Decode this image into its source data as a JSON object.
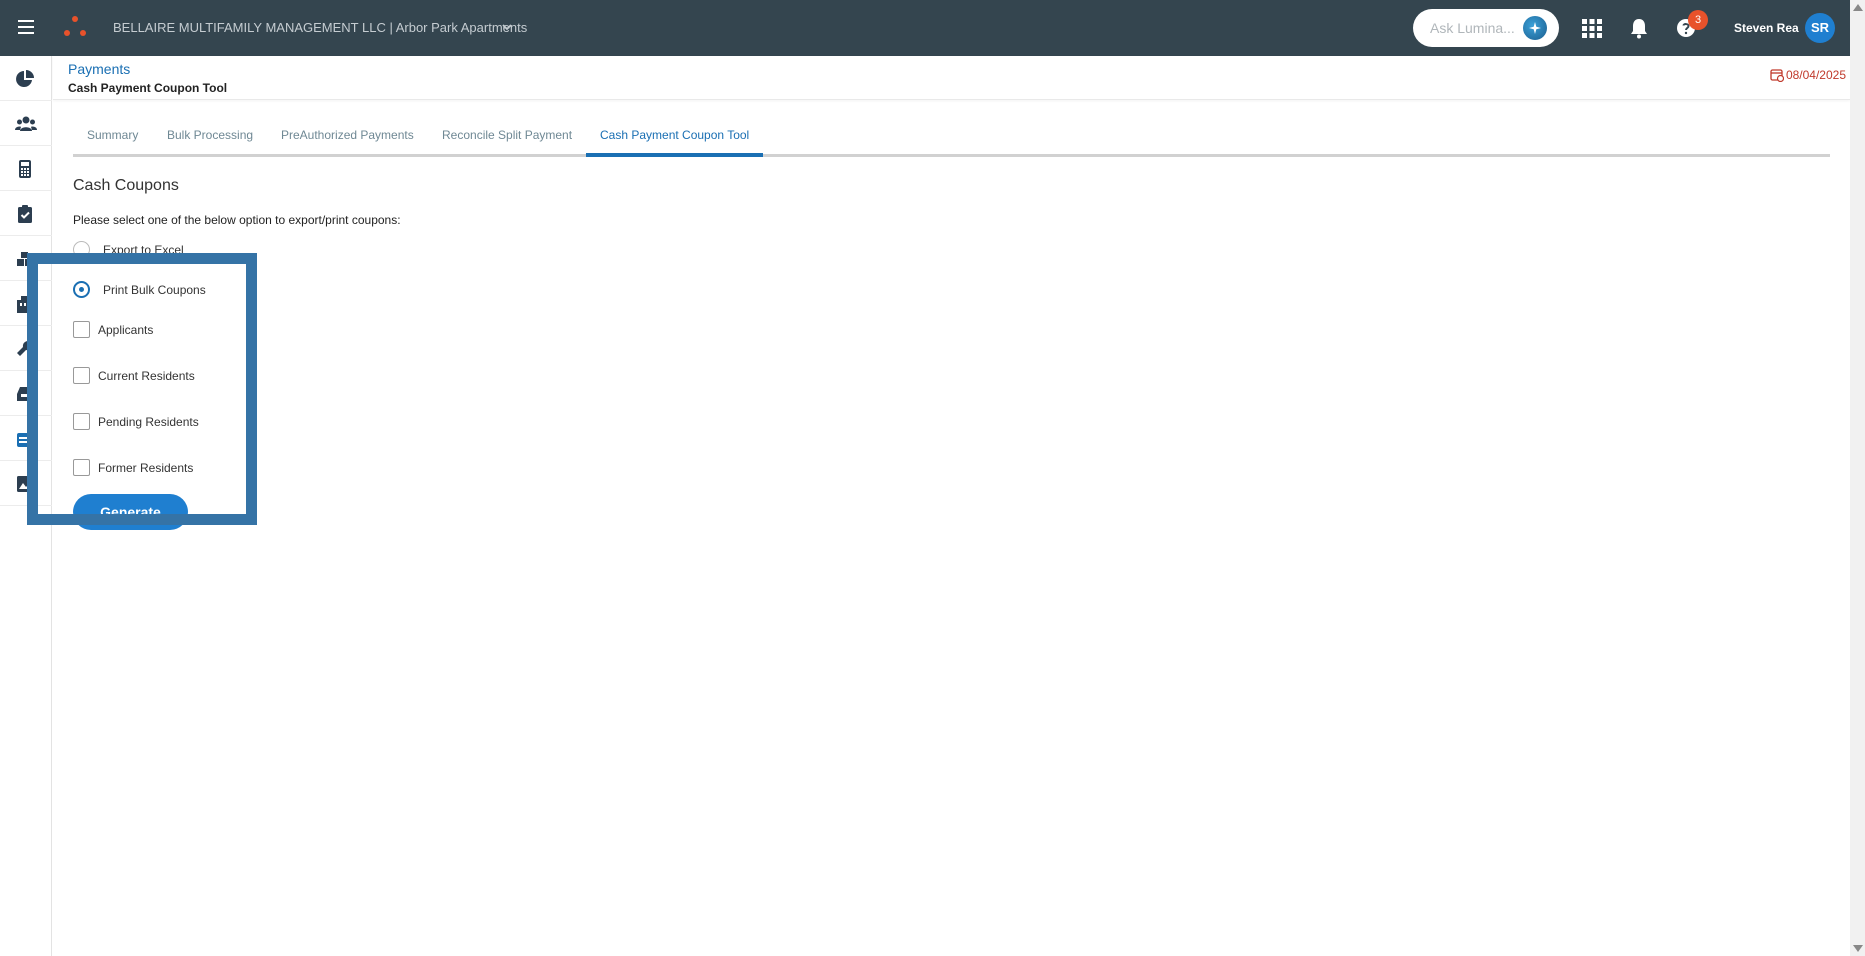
{
  "topbar": {
    "company": "BELLAIRE MULTIFAMILY MANAGEMENT LLC | Arbor Park Apartments",
    "ask_placeholder": "Ask Lumina...",
    "help_badge": "3",
    "user_name": "Steven Rea",
    "user_initials": "SR",
    "background": "#34454f",
    "accent": "#e8522b"
  },
  "sidebar": {
    "icons": [
      "pie-chart-icon",
      "people-icon",
      "calculator-icon",
      "clipboard-check-icon",
      "boxes-icon",
      "building-icon",
      "wrench-icon",
      "inbox-icon",
      "calendar-icon",
      "image-icon"
    ]
  },
  "header": {
    "breadcrumb": "Payments",
    "title": "Cash Payment Coupon Tool",
    "date": "08/04/2025"
  },
  "tabs": [
    {
      "label": "Summary",
      "active": false
    },
    {
      "label": "Bulk Processing",
      "active": false
    },
    {
      "label": "PreAuthorized Payments",
      "active": false
    },
    {
      "label": "Reconcile Split Payment",
      "active": false
    },
    {
      "label": "Cash Payment Coupon Tool",
      "active": true
    }
  ],
  "main": {
    "section_title": "Cash Coupons",
    "instructions": "Please select one of the below option to export/print coupons:",
    "options": [
      {
        "label": "Export to Excel",
        "selected": false
      },
      {
        "label": "Print Bulk Coupons",
        "selected": true
      }
    ],
    "checkboxes": [
      {
        "label": "Applicants",
        "checked": false
      },
      {
        "label": "Current Residents",
        "checked": false
      },
      {
        "label": "Pending Residents",
        "checked": false
      },
      {
        "label": "Former Residents",
        "checked": false
      }
    ],
    "generate_label": "Generate",
    "primary_color": "#1f7fd0",
    "highlight_color": "#3573a6"
  }
}
